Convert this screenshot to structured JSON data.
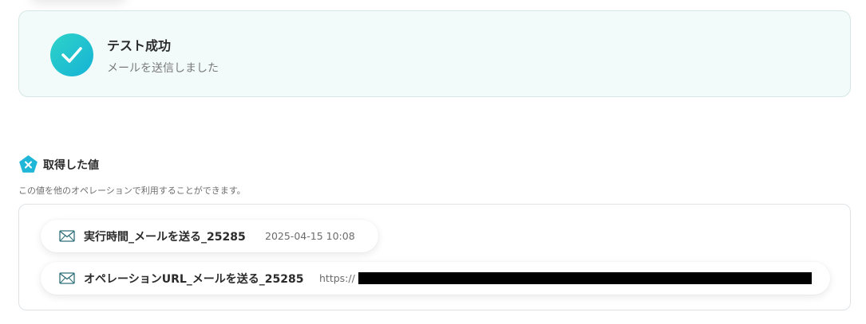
{
  "success": {
    "title": "テスト成功",
    "message": "メールを送信しました",
    "icon": "check-icon",
    "accent_color": "#1fc3cf"
  },
  "values_section": {
    "title": "取得した値",
    "description": "この値を他のオペレーションで利用することができます。",
    "icon": "variable-x-icon",
    "items": [
      {
        "icon": "mail-icon",
        "name": "実行時間_メールを送る_25285",
        "value": "2025-04-15 10:08"
      },
      {
        "icon": "mail-icon",
        "name": "オペレーションURL_メールを送る_25285",
        "value": "https://",
        "redacted": true
      }
    ]
  }
}
